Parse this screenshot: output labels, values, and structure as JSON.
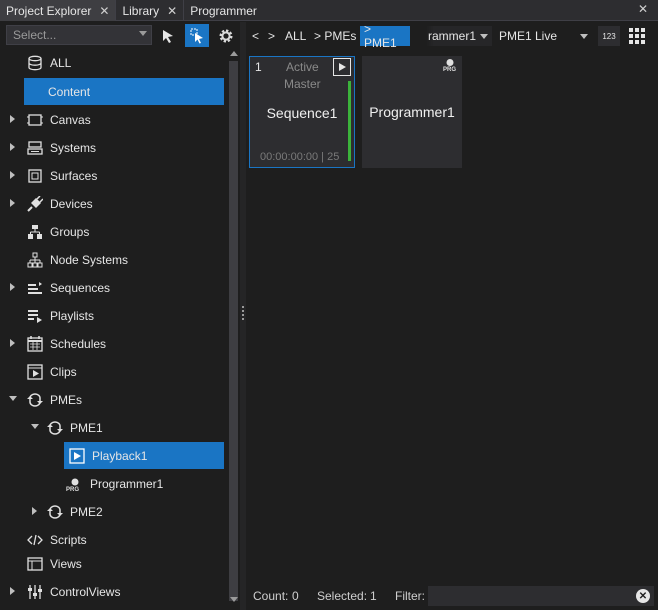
{
  "tabs": [
    {
      "label": "Project Explorer",
      "close": "✕",
      "active": true
    },
    {
      "label": "Library",
      "close": "✕",
      "active": false
    },
    {
      "label": "Programmer",
      "close": "",
      "active": false
    }
  ],
  "window_close": "✕",
  "left": {
    "select_placeholder": "Select...",
    "tree": [
      {
        "label": "ALL",
        "icon": "database-icon"
      },
      {
        "label": "Content",
        "icon": "none",
        "selected": true
      },
      {
        "label": "Canvas",
        "icon": "canvas-icon",
        "expandable": true
      },
      {
        "label": "Systems",
        "icon": "systems-icon",
        "expandable": true
      },
      {
        "label": "Surfaces",
        "icon": "surfaces-icon",
        "expandable": true
      },
      {
        "label": "Devices",
        "icon": "plug-icon",
        "expandable": true
      },
      {
        "label": "Groups",
        "icon": "groups-icon"
      },
      {
        "label": "Node Systems",
        "icon": "node-systems-icon"
      },
      {
        "label": "Sequences",
        "icon": "sequences-icon",
        "expandable": true
      },
      {
        "label": "Playlists",
        "icon": "playlists-icon"
      },
      {
        "label": "Schedules",
        "icon": "calendar-icon",
        "expandable": true
      },
      {
        "label": "Clips",
        "icon": "clips-icon"
      },
      {
        "label": "PMEs",
        "icon": "loop-icon",
        "expanded": true
      },
      {
        "label": "PME1",
        "icon": "loop-icon",
        "expanded": true
      },
      {
        "label": "Playback1",
        "icon": "play-icon",
        "selected": true
      },
      {
        "label": "Programmer1",
        "icon": "programmer-icon",
        "badge": "PRG"
      },
      {
        "label": "PME2",
        "icon": "loop-icon",
        "expandable": true
      },
      {
        "label": "Scripts",
        "icon": "code-icon"
      },
      {
        "label": "Views",
        "icon": "views-icon"
      },
      {
        "label": "ControlViews",
        "icon": "sliders-icon",
        "expandable": true
      }
    ]
  },
  "crumbs": {
    "back": "<",
    "forward": ">",
    "all": "ALL",
    "pmes": "> PMEs",
    "pme1": "> PME1",
    "programmer_dropdown": "rammer1",
    "live_dropdown": "PME1 Live",
    "numeric_toggle": "123"
  },
  "tiles": [
    {
      "index": "1",
      "state": "Active",
      "role": "Master",
      "name": "Sequence1",
      "timecode": "00:00:00:00 | 25"
    },
    {
      "name": "Programmer1",
      "badge": "PRG"
    }
  ],
  "status": {
    "count_label": "Count:",
    "count_value": "0",
    "selected_label": "Selected:",
    "selected_value": "1",
    "filter_label": "Filter:",
    "filter_clear": "✕"
  },
  "colors": {
    "accent": "#1a75c4",
    "live_bar": "#3bb33b"
  }
}
